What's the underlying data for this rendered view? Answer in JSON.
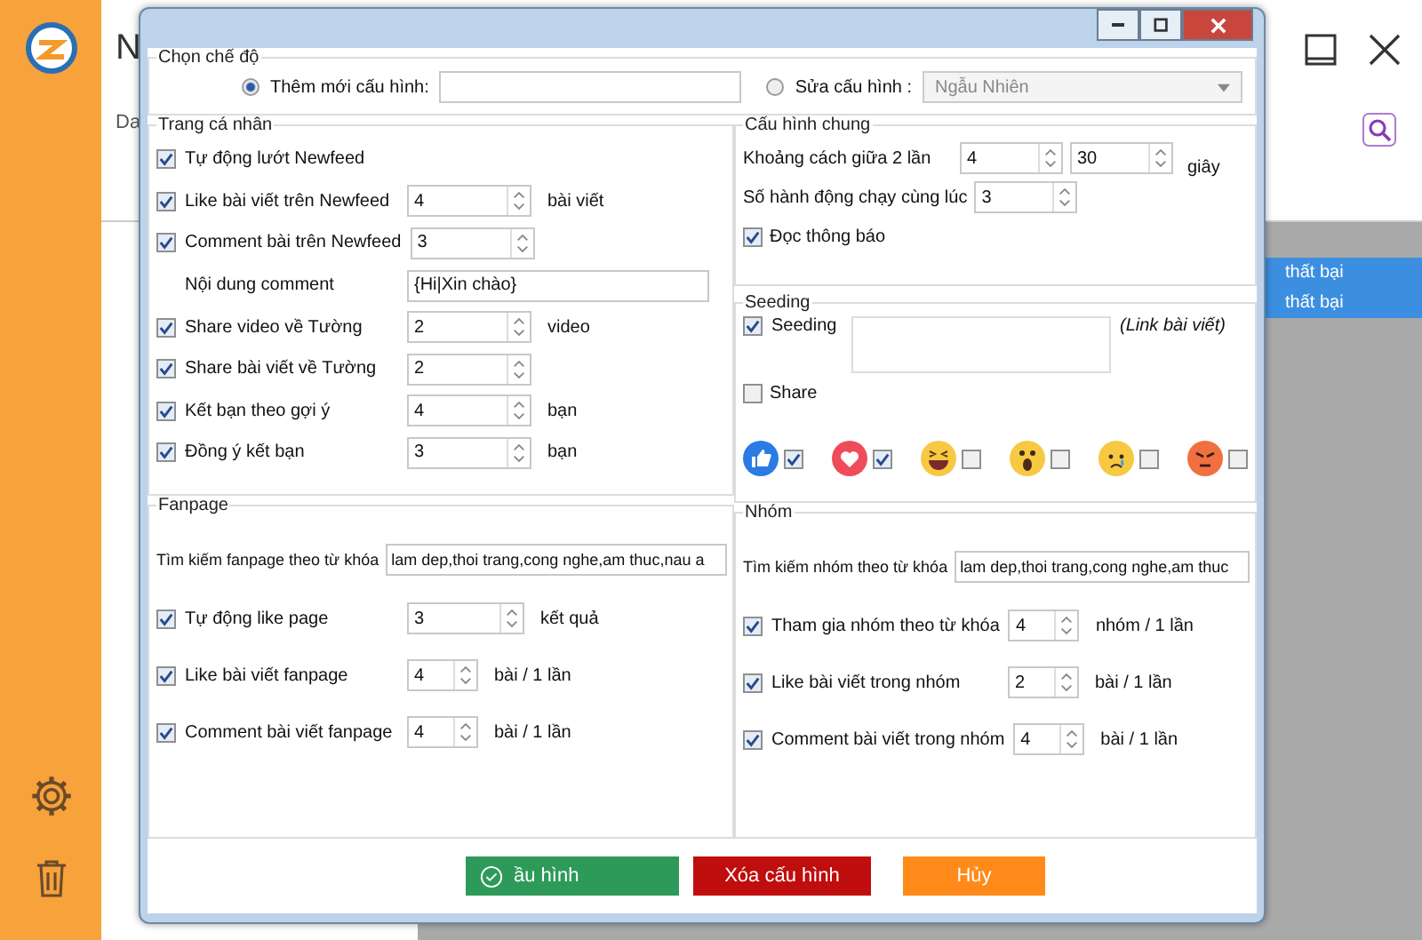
{
  "app": {
    "title": "N",
    "tab": "Da",
    "rows": [
      {
        "status": "thất bại",
        "selected": true
      },
      {
        "status": "thất bại",
        "selected": true
      }
    ]
  },
  "mode": {
    "title": "Chọn chế độ",
    "options": [
      {
        "label": "Thêm mới cấu hình:",
        "selected": true,
        "kind": "input"
      },
      {
        "label": "Sửa cấu hình :",
        "selected": false,
        "kind": "dropdown",
        "value": "Ngẫu Nhiên"
      }
    ]
  },
  "profile": {
    "title": "Trang cá nhân",
    "rows": [
      {
        "kind": "check",
        "label": "Tự động lướt Newfeed",
        "checked": true
      },
      {
        "kind": "spin",
        "label": "Like bài viết trên Newfeed",
        "checked": true,
        "value": "4",
        "unit": "bài viết"
      },
      {
        "kind": "spin",
        "label": "Comment bài trên Newfeed",
        "checked": true,
        "value": "3"
      },
      {
        "kind": "text",
        "label": "Nội dung comment",
        "value": "{Hi|Xin chào}"
      },
      {
        "kind": "spin",
        "label": "Share video về Tường",
        "checked": true,
        "value": "2",
        "unit": "video"
      },
      {
        "kind": "spin",
        "label": "Share bài viết về Tường",
        "checked": true,
        "value": "2"
      },
      {
        "kind": "spin",
        "label": "Kết bạn theo gợi ý",
        "checked": true,
        "value": "4",
        "unit": "bạn"
      },
      {
        "kind": "spin",
        "label": "Đồng ý kết bạn",
        "checked": true,
        "value": "3",
        "unit": "bạn"
      }
    ]
  },
  "general": {
    "title": "Cấu hình chung",
    "interval": {
      "label": "Khoảng cách giữa 2 lần",
      "from": "4",
      "to": "30",
      "unit": "giây"
    },
    "parallel": {
      "label": "Số hành động chạy cùng lúc",
      "value": "3"
    },
    "notify": {
      "label": "Đọc thông báo",
      "checked": true
    }
  },
  "seeding": {
    "title": "Seeding",
    "seed": {
      "label": "Seeding",
      "checked": true
    },
    "hint": "(Link bài viết)",
    "share": {
      "label": "Share",
      "checked": false
    },
    "reactions": [
      {
        "kind": "like",
        "checked": true
      },
      {
        "kind": "love",
        "checked": true
      },
      {
        "kind": "haha",
        "checked": false
      },
      {
        "kind": "wow",
        "checked": false
      },
      {
        "kind": "sad",
        "checked": false
      },
      {
        "kind": "angry",
        "checked": false
      }
    ]
  },
  "fanpage": {
    "title": "Fanpage",
    "search": {
      "label": "Tìm kiếm fanpage theo từ khóa",
      "value": "lam dep,thoi trang,cong nghe,am thuc,nau a"
    },
    "rows": [
      {
        "label": "Tự động like page",
        "checked": true,
        "value": "3",
        "unit": "kết quả"
      },
      {
        "label": "Like bài viết fanpage",
        "checked": true,
        "value": "4",
        "unit": "bài / 1 lần"
      },
      {
        "label": "Comment bài viết fanpage",
        "checked": true,
        "value": "4",
        "unit": "bài / 1 lần"
      }
    ]
  },
  "group": {
    "title": "Nhóm",
    "search": {
      "label": "Tìm kiếm nhóm theo từ khóa",
      "value": "lam dep,thoi trang,cong nghe,am thuc"
    },
    "rows": [
      {
        "label": "Tham gia nhóm theo từ khóa",
        "checked": true,
        "value": "4",
        "unit": "nhóm / 1 lần"
      },
      {
        "label": "Like bài viết trong nhóm",
        "checked": true,
        "value": "2",
        "unit": "bài / 1 lần"
      },
      {
        "label": "Comment bài viết trong nhóm",
        "checked": true,
        "value": "4",
        "unit": "bài / 1 lần"
      }
    ]
  },
  "buttons": [
    {
      "kind": "save",
      "label": "ầu hình"
    },
    {
      "kind": "delete",
      "label": "Xóa cấu hình"
    },
    {
      "kind": "cancel",
      "label": "Hủy"
    }
  ]
}
